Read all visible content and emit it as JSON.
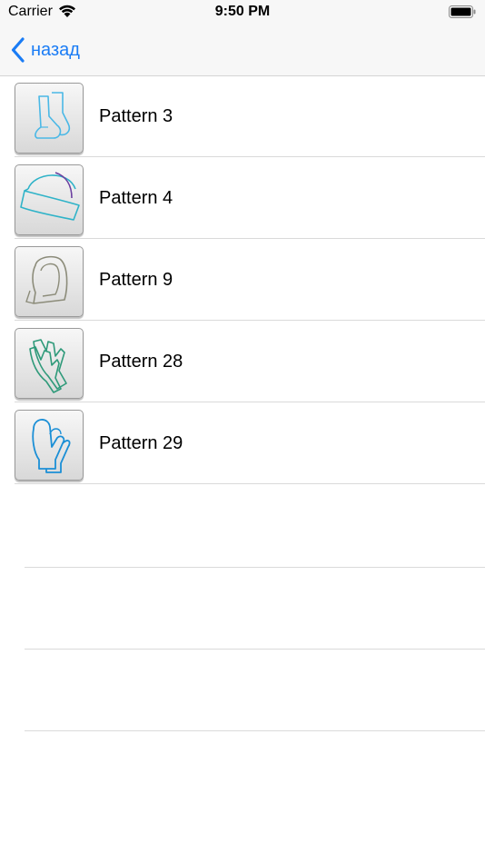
{
  "status_bar": {
    "carrier": "Carrier",
    "time": "9:50 PM"
  },
  "nav": {
    "back_label": "назад"
  },
  "patterns": [
    {
      "label": "Pattern 3",
      "icon": "socks-icon",
      "color": "#4ab8e6"
    },
    {
      "label": "Pattern 4",
      "icon": "hat-icon",
      "color": "#2fb3c8"
    },
    {
      "label": "Pattern 9",
      "icon": "hood-icon",
      "color": "#8c8c7a"
    },
    {
      "label": "Pattern 28",
      "icon": "gloves-icon",
      "color": "#2f9a7a"
    },
    {
      "label": "Pattern 29",
      "icon": "mittens-icon",
      "color": "#1b8fd6"
    }
  ],
  "colors": {
    "accent": "#1a7cf5",
    "separator": "#dadada"
  }
}
